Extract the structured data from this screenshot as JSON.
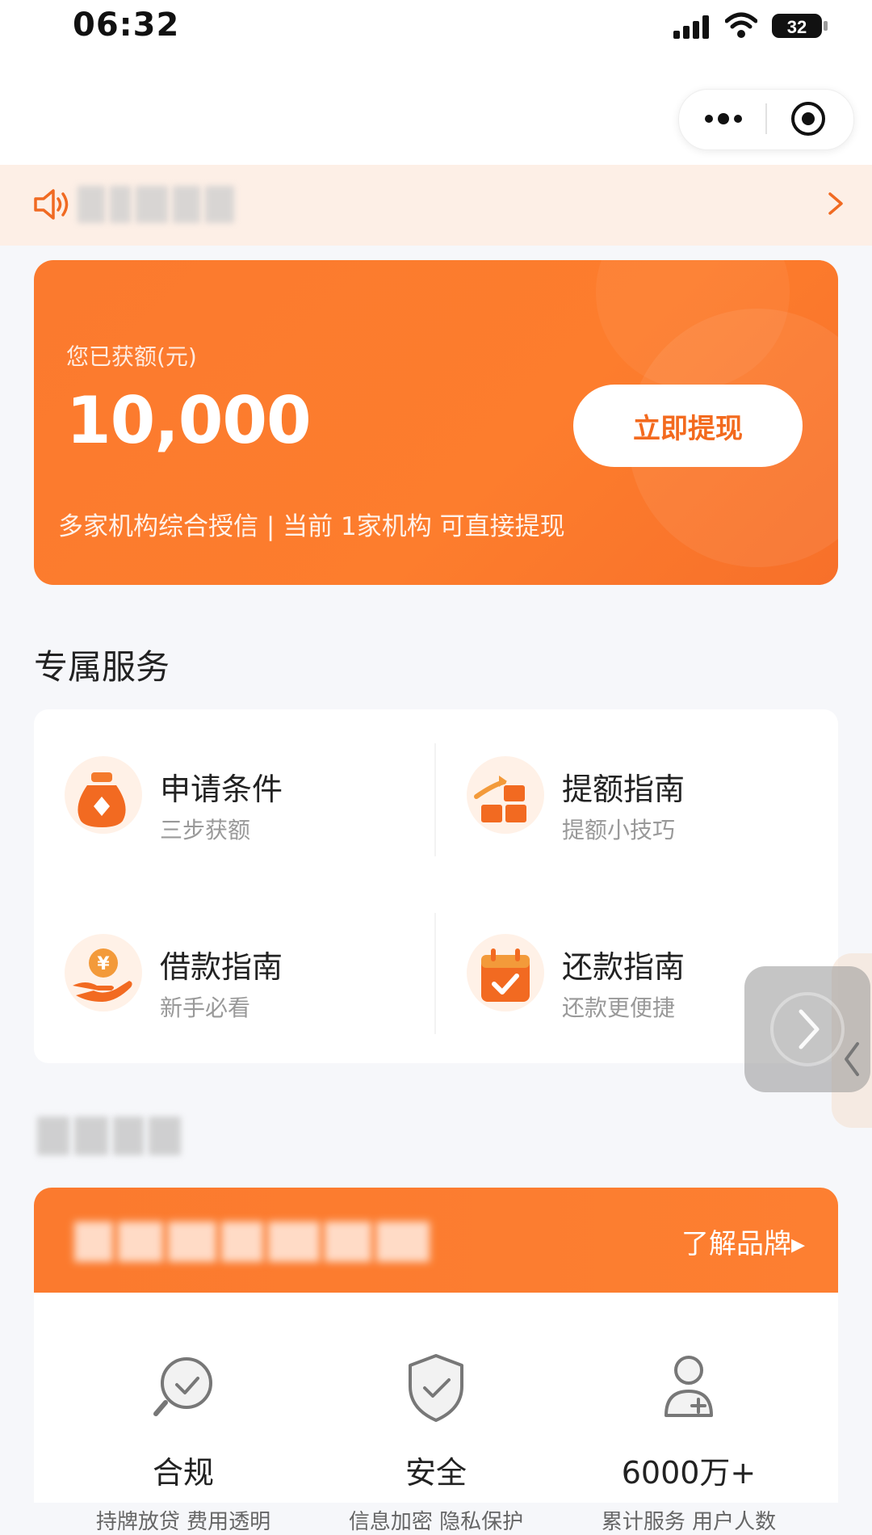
{
  "status_bar": {
    "time": "06:32",
    "battery": "32"
  },
  "hero": {
    "caption": "您已获额(元)",
    "amount": "10,000",
    "withdraw_label": "立即提现",
    "subtitle": "多家机构综合授信 | 当前 1家机构 可直接提现"
  },
  "services": {
    "title": "专属服务",
    "items": [
      {
        "title": "申请条件",
        "subtitle": "三步获额",
        "icon": "money-bag-icon"
      },
      {
        "title": "提额指南",
        "subtitle": "提额小技巧",
        "icon": "growth-chart-icon"
      },
      {
        "title": "借款指南",
        "subtitle": "新手必看",
        "icon": "hand-coin-icon"
      },
      {
        "title": "还款指南",
        "subtitle": "还款更便捷",
        "icon": "calendar-check-icon"
      }
    ]
  },
  "brand": {
    "link_label": "了解品牌▸"
  },
  "features": [
    {
      "title": "合规",
      "subtitle": "持牌放贷 费用透明",
      "icon": "magnifier-check-icon"
    },
    {
      "title": "安全",
      "subtitle": "信息加密 隐私保护",
      "icon": "shield-check-icon"
    },
    {
      "title": "6000万+",
      "subtitle": "累计服务 用户人数",
      "icon": "user-add-icon"
    }
  ],
  "colors": {
    "accent": "#fb7a2e",
    "notice_bg": "#fdefe6",
    "page_bg": "#f6f7fa"
  }
}
